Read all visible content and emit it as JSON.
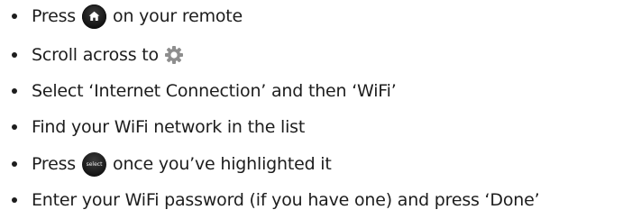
{
  "steps": [
    {
      "before": "Press",
      "icon": "home-button-icon",
      "after": "on your remote"
    },
    {
      "before": "Scroll across to",
      "icon": "settings-gear-icon",
      "after": ""
    },
    {
      "before": "Select ‘Internet Connection’ and then ‘WiFi’",
      "icon": "",
      "after": ""
    },
    {
      "before": "Find your WiFi network in the list",
      "icon": "",
      "after": ""
    },
    {
      "before": "Press",
      "icon": "select-button-icon",
      "after": "once you’ve highlighted it"
    },
    {
      "before": "Enter your WiFi password (if you have one) and press ‘Done’",
      "icon": "",
      "after": ""
    }
  ],
  "select_button_text": "select"
}
